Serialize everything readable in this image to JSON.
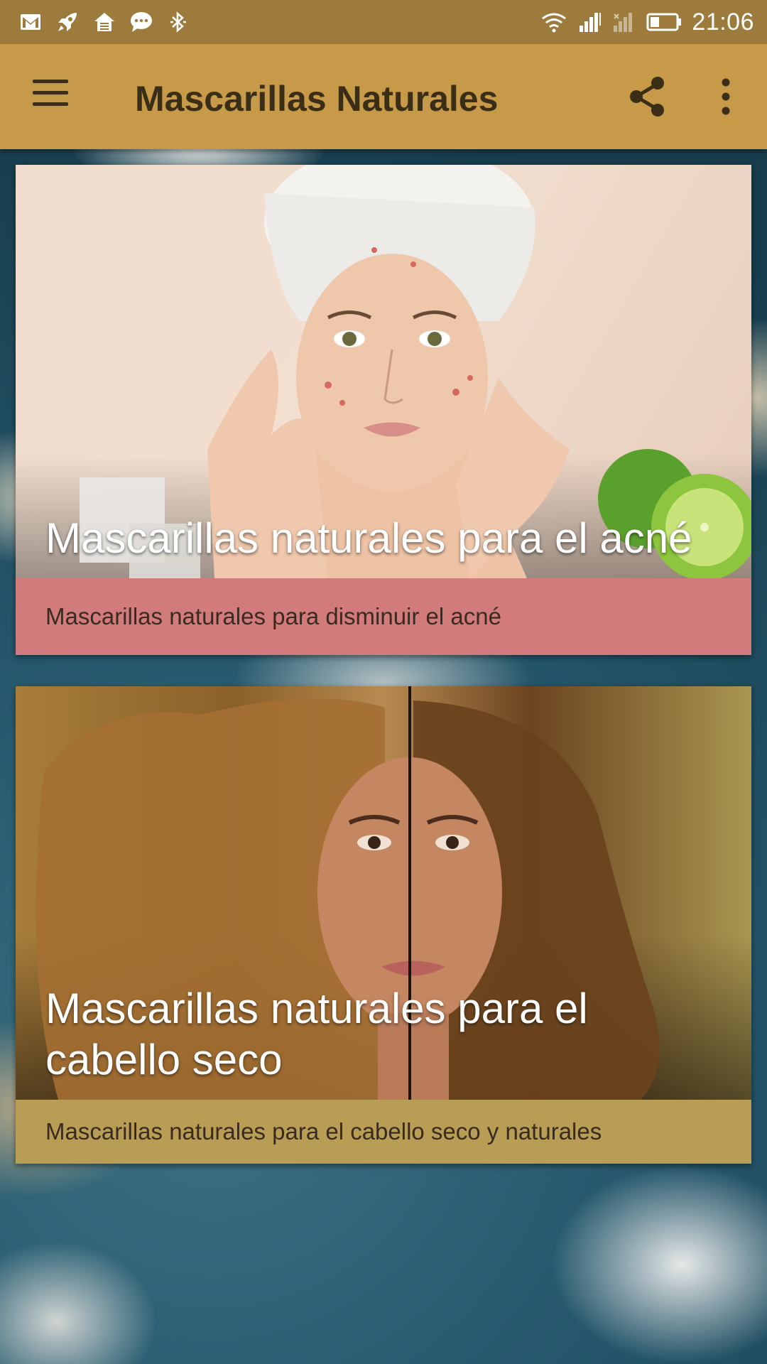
{
  "status_bar": {
    "time": "21:06",
    "left_icons": [
      "gmail-icon",
      "rocket-icon",
      "home-icon",
      "chat-bubble-icon",
      "bluetooth-off-icon"
    ],
    "right_icons": [
      "wifi-icon",
      "signal-icon",
      "signal-no-sim-icon",
      "battery-icon"
    ]
  },
  "app_bar": {
    "title": "Mascarillas Naturales",
    "icons": [
      "menu-icon",
      "share-icon",
      "more-vert-icon"
    ]
  },
  "cards": [
    {
      "title": "Mascarillas naturales para el acné",
      "description": "Mascarillas naturales para disminuir el acné",
      "desc_color": "#d27b7c"
    },
    {
      "title": "Mascarillas naturales para el cabello seco",
      "description": "Mascarillas naturales para el cabello seco y naturales",
      "desc_color": "#b89d55"
    }
  ],
  "colors": {
    "status_bar": "#9c7b3c",
    "app_bar": "#c69a48",
    "app_bar_text": "#3b2e17"
  }
}
